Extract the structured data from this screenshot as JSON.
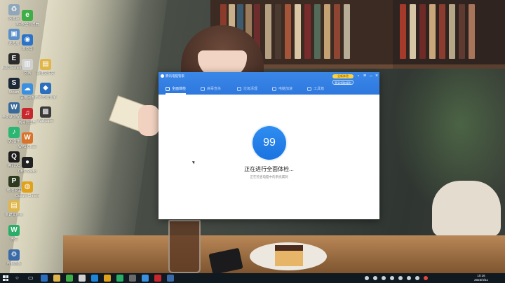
{
  "desktop": {
    "icons": [
      {
        "id": "recycle-bin",
        "label": "回收站",
        "color": "#8fa7b8",
        "glyph": "♻"
      },
      {
        "id": "computer",
        "label": "此电脑",
        "color": "#5b8fc9",
        "glyph": "▣"
      },
      {
        "id": "epic",
        "label": "Epic Games Launcher",
        "color": "#2b2b2b",
        "glyph": "E"
      },
      {
        "id": "steam",
        "label": "Steam",
        "color": "#1b2838",
        "glyph": "S"
      },
      {
        "id": "game-a",
        "label": "英雄联盟WeGame版",
        "color": "#3a6a9a",
        "glyph": "W"
      },
      {
        "id": "qq-music",
        "label": "QQ音乐",
        "color": "#2bb673",
        "glyph": "♪"
      },
      {
        "id": "qq",
        "label": "腾讯QQ",
        "color": "#1d1d1d",
        "glyph": "Q"
      },
      {
        "id": "pubg",
        "label": "绝地求生",
        "color": "#2d3a1f",
        "glyph": "P"
      },
      {
        "id": "folder",
        "label": "新建文件夹",
        "color": "#e0b64a",
        "glyph": "▤"
      },
      {
        "id": "wechat",
        "label": "微信",
        "color": "#2aae67",
        "glyph": "W"
      },
      {
        "id": "settings",
        "label": "控制面板",
        "color": "#3a6aa8",
        "glyph": "⚙"
      }
    ],
    "icons_col2": [
      {
        "id": "net-tool",
        "label": "360安全浏览器",
        "color": "#3fae49",
        "glyph": "e"
      },
      {
        "id": "browser",
        "label": "浏览器",
        "color": "#2c73c8",
        "glyph": "◉"
      },
      {
        "id": "doc",
        "label": "文档",
        "color": "#d0d0d0",
        "glyph": "▥"
      },
      {
        "id": "cloud",
        "label": "百度网盘",
        "color": "#3a8fe0",
        "glyph": "☁"
      },
      {
        "id": "netease",
        "label": "网易云音乐",
        "color": "#c8282d",
        "glyph": "♫"
      },
      {
        "id": "office",
        "label": "WPS Office",
        "color": "#d9722a",
        "glyph": "W"
      },
      {
        "id": "video",
        "label": "OBS Studio",
        "color": "#222",
        "glyph": "●"
      },
      {
        "id": "chrome",
        "label": "Google Chrome",
        "color": "#e0a21c",
        "glyph": "◍"
      }
    ],
    "icons_col3": [
      {
        "id": "folder2",
        "label": "新建文件夹",
        "color": "#e0b64a",
        "glyph": "▤"
      },
      {
        "id": "tool",
        "label": "腾讯电脑管家",
        "color": "#2d6fbf",
        "glyph": "◆"
      },
      {
        "id": "game-b",
        "label": "Wallpaper",
        "color": "#3a3a3a",
        "glyph": "▩"
      }
    ]
  },
  "window": {
    "title": "腾讯电脑管家",
    "promo": "全新体验",
    "login": "登录领取福利",
    "tabs": [
      {
        "label": "全面体检",
        "active": true
      },
      {
        "label": "病毒查杀",
        "active": false
      },
      {
        "label": "垃圾清理",
        "active": false
      },
      {
        "label": "电脑加速",
        "active": false
      },
      {
        "label": "工具箱",
        "active": false
      }
    ],
    "score": "99",
    "status": "正在进行全面体检...",
    "sub_status": "正在检查电脑中的系统漏洞"
  },
  "taskbar": {
    "time": "10:16",
    "date": "2023/4/11",
    "apps": [
      "#2d6fbf",
      "#e0b64a",
      "#3fae49",
      "#d0d0d0",
      "#1d86d8",
      "#e0a21c",
      "#2aae67",
      "#6a6a6a",
      "#3a8fe0",
      "#c8282d",
      "#3a6aa8"
    ]
  }
}
